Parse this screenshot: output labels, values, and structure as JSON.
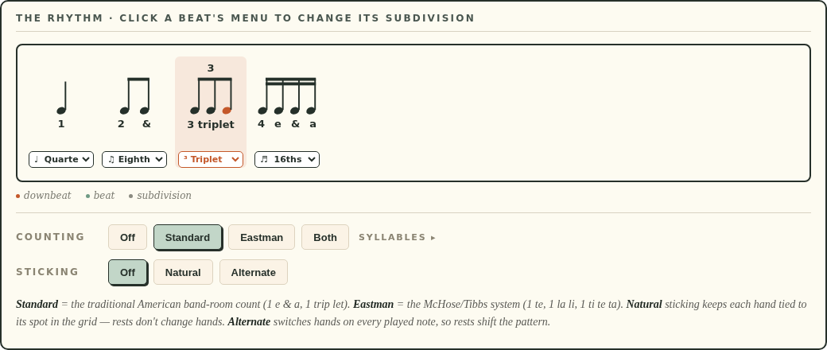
{
  "title": "THE RHYTHM · CLICK A BEAT'S MENU TO CHANGE ITS SUBDIVISION",
  "beats": [
    {
      "kind": "quarter",
      "selected": false,
      "notes": [
        {
          "color": "#25302a"
        }
      ],
      "syllables": [
        "1"
      ],
      "menu": "♩  Quarte"
    },
    {
      "kind": "eighths",
      "selected": false,
      "notes": [
        {
          "color": "#25302a"
        },
        {
          "color": "#25302a"
        }
      ],
      "syllables": [
        "2",
        "&"
      ],
      "menu": "♫ Eighth"
    },
    {
      "kind": "triplet",
      "selected": true,
      "tuplet": "3",
      "notes": [
        {
          "color": "#25302a"
        },
        {
          "color": "#25302a"
        },
        {
          "color": "#c4582a"
        }
      ],
      "syllables": [
        "3 triplet"
      ],
      "menu": "³ Triplet"
    },
    {
      "kind": "sixteenths",
      "selected": false,
      "notes": [
        {
          "color": "#25302a"
        },
        {
          "color": "#25302a"
        },
        {
          "color": "#25302a"
        },
        {
          "color": "#25302a"
        }
      ],
      "syllables": [
        "4",
        "e",
        "&",
        "a"
      ],
      "menu": "♬  16ths"
    }
  ],
  "legend": [
    {
      "label": "downbeat",
      "color": "#c4582a"
    },
    {
      "label": "beat",
      "color": "#6f9a84"
    },
    {
      "label": "subdivision",
      "color": "#8a8a80"
    }
  ],
  "controls": [
    {
      "label": "COUNTING",
      "options": [
        {
          "label": "Off",
          "selected": false
        },
        {
          "label": "Standard",
          "selected": true
        },
        {
          "label": "Eastman",
          "selected": false
        },
        {
          "label": "Both",
          "selected": false
        }
      ],
      "link": "SYLLABLES ▸"
    },
    {
      "label": "STICKING",
      "options": [
        {
          "label": "Off",
          "selected": true
        },
        {
          "label": "Natural",
          "selected": false
        },
        {
          "label": "Alternate",
          "selected": false
        }
      ]
    }
  ],
  "note": "**Standard** = the traditional American band-room count (1 e & a, 1 trip let). **Eastman** = the McHose/Tibbs system (1 te, 1 la li, 1 ti te ta). **Natural** sticking keeps each hand tied to its spot in the grid — rests don't change hands. **Alternate** switches hands on every played note, so rests shift the pattern."
}
